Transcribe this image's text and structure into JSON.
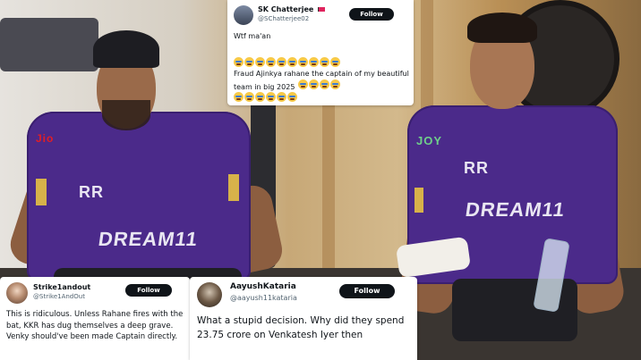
{
  "tweets": {
    "top": {
      "display_name": "SK Chatterjee",
      "flag_icon": "red-flag-icon",
      "handle": "@SChatterjee02",
      "follow_label": "Follow",
      "line1": "Wtf ma'an",
      "body": "Fraud Ajinkya rahane the captain of my beautiful team in big 2025",
      "emoji_name": "loudly-crying-face-icon",
      "emoji_rows": [
        10,
        4,
        6
      ]
    },
    "bottom_left": {
      "display_name": "Strike1andout",
      "handle": "@Strike1AndOut",
      "follow_label": "Follow",
      "body": "This is ridiculous. Unless Rahane fires with the bat, KKR has dug themselves a deep grave. Venky should've been made Captain directly."
    },
    "bottom_right": {
      "display_name": "AayushKataria",
      "handle": "@aayush11kataria",
      "follow_label": "Follow",
      "body": "What a stupid decision.  Why did they spend 23.75 crore on Venkatesh Iyer then"
    }
  },
  "photo": {
    "jersey_sponsor": "DREAM11",
    "jersey_brand": "RR",
    "jersey_chest_left": "Jio",
    "jersey_chest_right": "JOY"
  },
  "colors": {
    "jersey_purple": "#4b2a8a",
    "jersey_gold": "#d7b24a",
    "follow_button": "#0f1419",
    "card_bg": "#ffffff",
    "handle_gray": "#536471"
  }
}
